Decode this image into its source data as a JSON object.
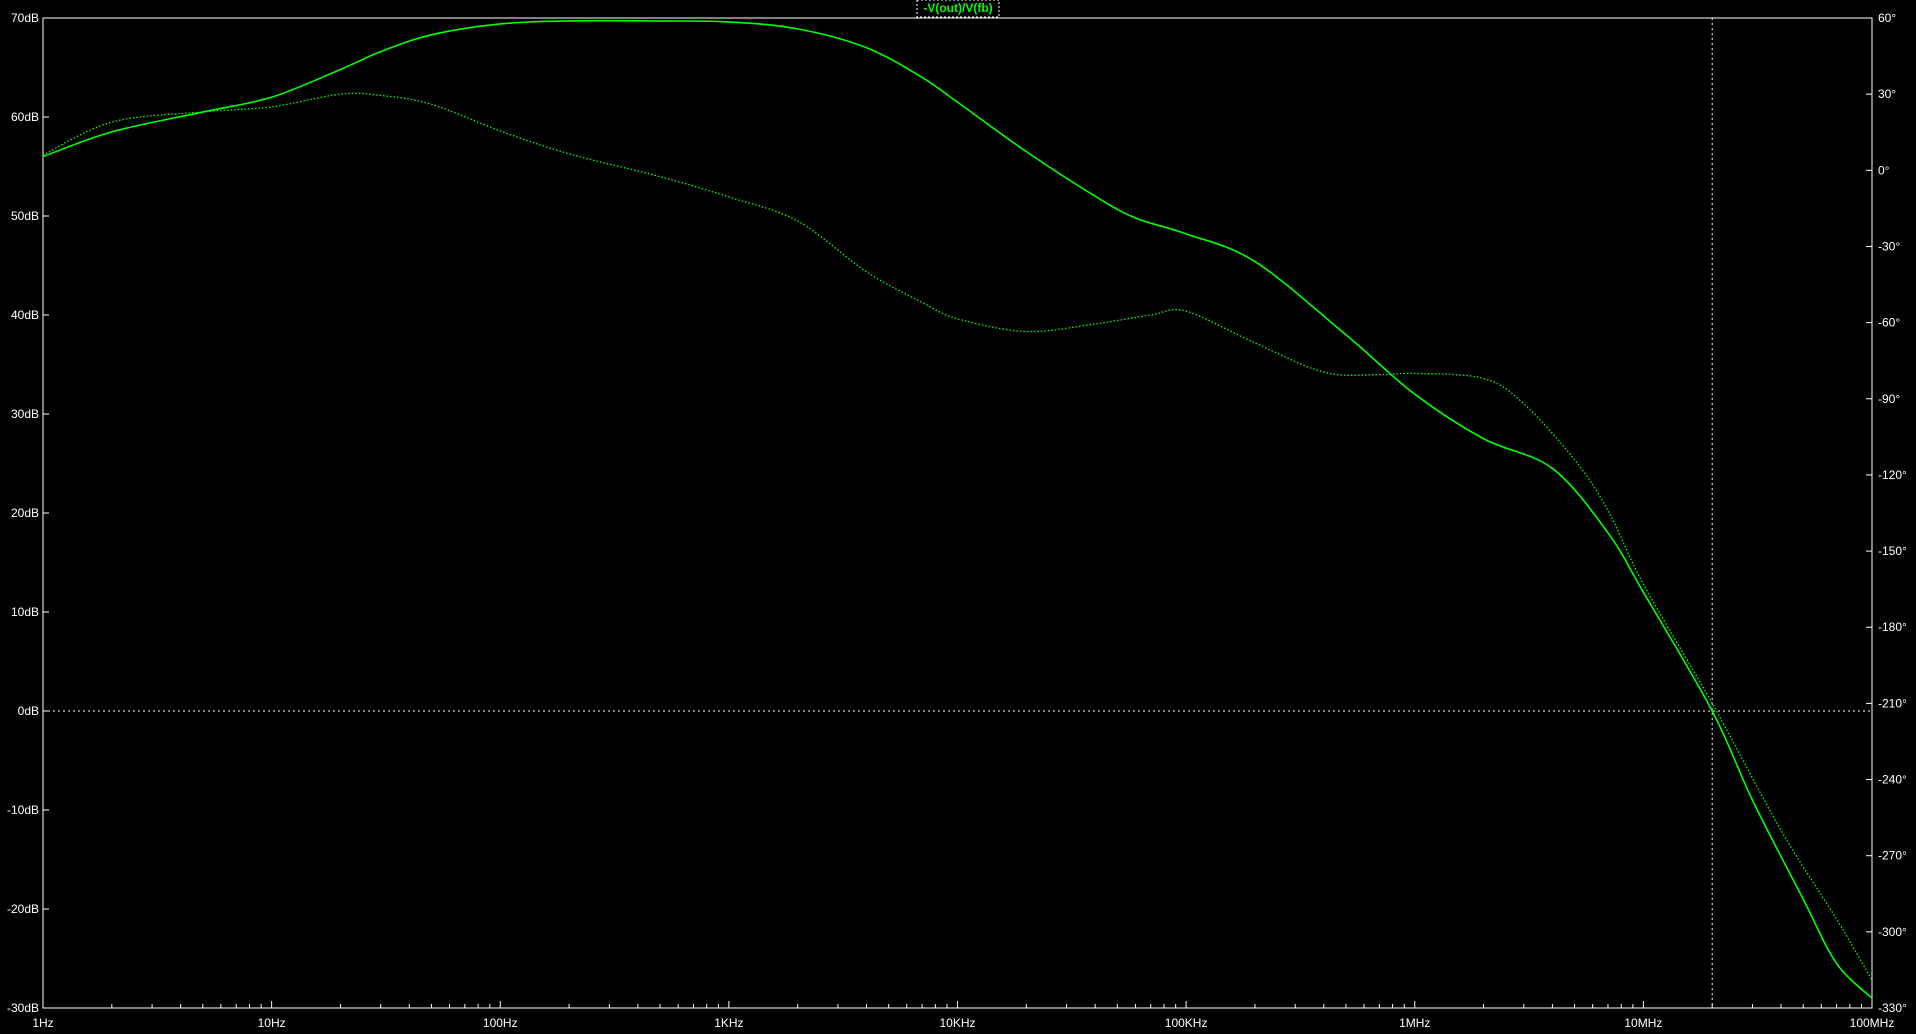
{
  "chart_data": {
    "type": "line",
    "title": "-V(out)/V(fb)",
    "xscale": "log",
    "x_range_hz": [
      1,
      100000000
    ],
    "x_ticks": [
      {
        "hz": 1,
        "label": "1Hz"
      },
      {
        "hz": 10,
        "label": "10Hz"
      },
      {
        "hz": 100,
        "label": "100Hz"
      },
      {
        "hz": 1000,
        "label": "1KHz"
      },
      {
        "hz": 10000,
        "label": "10KHz"
      },
      {
        "hz": 100000,
        "label": "100KHz"
      },
      {
        "hz": 1000000,
        "label": "1MHz"
      },
      {
        "hz": 10000000,
        "label": "10MHz"
      },
      {
        "hz": 100000000,
        "label": "100MHz"
      }
    ],
    "y_left_range_db": [
      -30,
      70
    ],
    "y_left_ticks": [
      {
        "value": 70,
        "label": "70dB"
      },
      {
        "value": 60,
        "label": "60dB"
      },
      {
        "value": 50,
        "label": "50dB"
      },
      {
        "value": 40,
        "label": "40dB"
      },
      {
        "value": 30,
        "label": "30dB"
      },
      {
        "value": 20,
        "label": "20dB"
      },
      {
        "value": 10,
        "label": "10dB"
      },
      {
        "value": 0,
        "label": "0dB"
      },
      {
        "value": -10,
        "label": "-10dB"
      },
      {
        "value": -20,
        "label": "-20dB"
      },
      {
        "value": -30,
        "label": "-30dB"
      }
    ],
    "y_right_range_deg": [
      -330,
      60
    ],
    "y_right_ticks": [
      {
        "value": 60,
        "label": "60°"
      },
      {
        "value": 30,
        "label": "30°"
      },
      {
        "value": 0,
        "label": "0°"
      },
      {
        "value": -30,
        "label": "-30°"
      },
      {
        "value": -60,
        "label": "-60°"
      },
      {
        "value": -90,
        "label": "-90°"
      },
      {
        "value": -120,
        "label": "-120°"
      },
      {
        "value": -150,
        "label": "-150°"
      },
      {
        "value": -180,
        "label": "-180°"
      },
      {
        "value": -210,
        "label": "-210°"
      },
      {
        "value": -240,
        "label": "-240°"
      },
      {
        "value": -270,
        "label": "-270°"
      },
      {
        "value": -300,
        "label": "-300°"
      },
      {
        "value": -330,
        "label": "-330°"
      }
    ],
    "grid": false,
    "series": [
      {
        "kind": "magnitude",
        "axis": "left",
        "style": "solid",
        "color": "#00ff00",
        "points": [
          [
            1,
            56.0
          ],
          [
            2,
            58.5
          ],
          [
            5,
            60.5
          ],
          [
            10,
            62.0
          ],
          [
            20,
            64.8
          ],
          [
            30,
            66.6
          ],
          [
            50,
            68.3
          ],
          [
            100,
            69.4
          ],
          [
            200,
            69.7
          ],
          [
            500,
            69.7
          ],
          [
            1000,
            69.6
          ],
          [
            2000,
            68.9
          ],
          [
            4000,
            67.0
          ],
          [
            7000,
            64.0
          ],
          [
            10000,
            61.5
          ],
          [
            20000,
            56.5
          ],
          [
            40000,
            52.0
          ],
          [
            60000,
            49.8
          ],
          [
            100000,
            48.2
          ],
          [
            200000,
            45.4
          ],
          [
            500000,
            38.0
          ],
          [
            1000000,
            32.0
          ],
          [
            2000000,
            27.5
          ],
          [
            4000000,
            24.5
          ],
          [
            7000000,
            18.0
          ],
          [
            10000000,
            12.0
          ],
          [
            20000000,
            0.0
          ],
          [
            30000000,
            -9.0
          ],
          [
            50000000,
            -19.0
          ],
          [
            70000000,
            -25.5
          ],
          [
            100000000,
            -29.0
          ]
        ]
      },
      {
        "kind": "phase",
        "axis": "right",
        "style": "dotted",
        "color": "#00ff00",
        "points": [
          [
            1,
            6.0
          ],
          [
            2,
            19.0
          ],
          [
            5,
            23.0
          ],
          [
            10,
            25.0
          ],
          [
            20,
            30.0
          ],
          [
            30,
            29.5
          ],
          [
            50,
            26.0
          ],
          [
            100,
            15.5
          ],
          [
            200,
            6.5
          ],
          [
            500,
            -2.5
          ],
          [
            1000,
            -10.5
          ],
          [
            2000,
            -20.0
          ],
          [
            4000,
            -40.0
          ],
          [
            7000,
            -52.0
          ],
          [
            10000,
            -58.5
          ],
          [
            20000,
            -63.5
          ],
          [
            40000,
            -60.5
          ],
          [
            70000,
            -57.0
          ],
          [
            100000,
            -55.5
          ],
          [
            200000,
            -68.0
          ],
          [
            400000,
            -79.5
          ],
          [
            700000,
            -80.5
          ],
          [
            1000000,
            -80.0
          ],
          [
            2000000,
            -82.0
          ],
          [
            3000000,
            -92.0
          ],
          [
            5000000,
            -114.0
          ],
          [
            7000000,
            -134.0
          ],
          [
            10000000,
            -163.0
          ],
          [
            20000000,
            -210.0
          ],
          [
            40000000,
            -260.0
          ],
          [
            70000000,
            -295.0
          ],
          [
            100000000,
            -319.0
          ]
        ]
      }
    ],
    "cursor": {
      "x_hz": 20000000,
      "y_db": 0
    }
  }
}
